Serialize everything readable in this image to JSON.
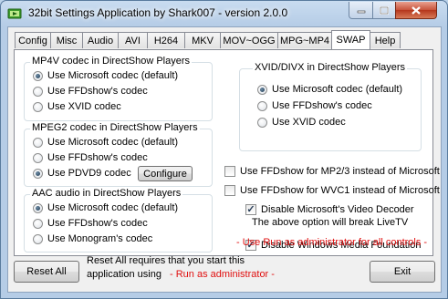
{
  "window": {
    "title": "32bit Settings Application by Shark007 - version 2.0.0"
  },
  "tabs": [
    {
      "label": "Config"
    },
    {
      "label": "Misc"
    },
    {
      "label": "Audio"
    },
    {
      "label": "AVI"
    },
    {
      "label": "H264"
    },
    {
      "label": "MKV"
    },
    {
      "label": "MOV~OGG"
    },
    {
      "label": "MPG~MP4"
    },
    {
      "label": "SWAP"
    },
    {
      "label": "Help"
    }
  ],
  "active_tab": "SWAP",
  "mp4v": {
    "title": "MP4V codec in DirectShow Players",
    "options": [
      "Use Microsoft codec (default)",
      "Use FFDshow's codec",
      "Use XVID codec"
    ],
    "selected": 0
  },
  "mpeg2": {
    "title": "MPEG2 codec in DirectShow Players",
    "options": [
      "Use Microsoft codec (default)",
      "Use FFDshow's codec",
      "Use PDVD9 codec"
    ],
    "selected": 2,
    "configure_label": "Configure"
  },
  "aac": {
    "title": "AAC audio in DirectShow Players",
    "options": [
      "Use Microsoft codec (default)",
      "Use FFDshow's codec",
      "Use Monogram's codec"
    ],
    "selected": 0
  },
  "xvid": {
    "title": "XVID/DIVX in DirectShow Players",
    "options": [
      "Use Microsoft codec (default)",
      "Use FFDshow's codec",
      "Use XVID codec"
    ],
    "selected": 0
  },
  "checks": {
    "mp23": {
      "label": "Use FFDshow for MP2/3 instead of Microsoft",
      "checked": false
    },
    "wvc1": {
      "label": "Use FFDshow for WVC1 instead of Microsoft",
      "checked": false
    },
    "disable_decoder": {
      "label": "Disable Microsoft's Video Decoder",
      "checked": true
    },
    "decoder_note": "The above option will break LiveTV",
    "disable_wmf": {
      "label": "Disable Windows Media Foundation",
      "checked": true
    }
  },
  "admin_notice": "- Use Run as administrator for all controls -",
  "footer": {
    "reset_label": "Reset All",
    "reset_note_line1": "Reset All requires that you start this",
    "reset_note_line2": "application using",
    "reset_note_admin": "- Run as administrator -",
    "exit_label": "Exit"
  }
}
